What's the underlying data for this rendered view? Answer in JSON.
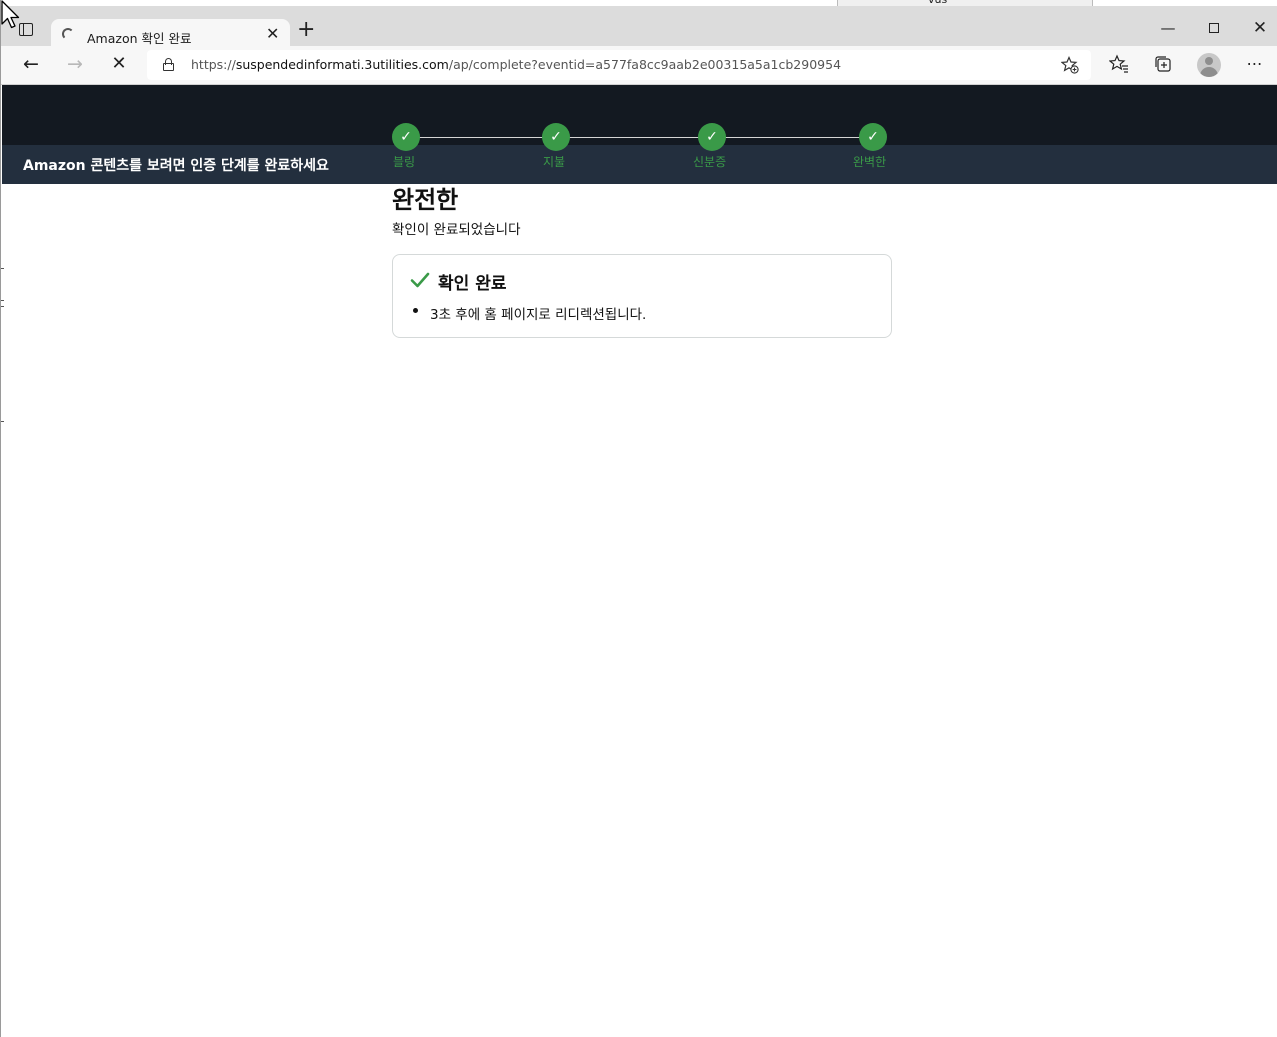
{
  "browser": {
    "tab_title": "Amazon 확인 완료",
    "url_prefix": "https://",
    "url_host": "suspendedinformati.3utilities.com",
    "url_path": "/ap/complete?eventid=a577fa8cc9aab2e00315a5a1cb290954",
    "icons": {
      "tab_actions": "tab-actions-icon",
      "back": "back-arrow-icon",
      "forward": "forward-arrow-icon",
      "stop": "stop-loading-icon",
      "lock": "lock-icon",
      "add_favorite": "add-favorite-icon",
      "favorites": "favorites-icon",
      "collections": "collections-icon",
      "profile": "profile-icon",
      "more": "more-icon"
    },
    "behind_window_text": "vus"
  },
  "page": {
    "subheader_text": "Amazon 콘텐츠를 보려면 인증 단계를 완료하세요",
    "steps": [
      {
        "label": "블링",
        "mark": "✓"
      },
      {
        "label": "지불",
        "mark": "✓"
      },
      {
        "label": "신분증",
        "mark": "✓"
      },
      {
        "label": "완벽한",
        "mark": "✓"
      }
    ],
    "title": "완전한",
    "subtitle": "확인이 완료되었습니다",
    "alert": {
      "title": "확인 완료",
      "message": "3초 후에 홈 페이지로 리디렉션됩니다."
    }
  },
  "colors": {
    "header_bg": "#131921",
    "subheader_bg": "#232f3e",
    "step_green": "#3a9a48"
  }
}
